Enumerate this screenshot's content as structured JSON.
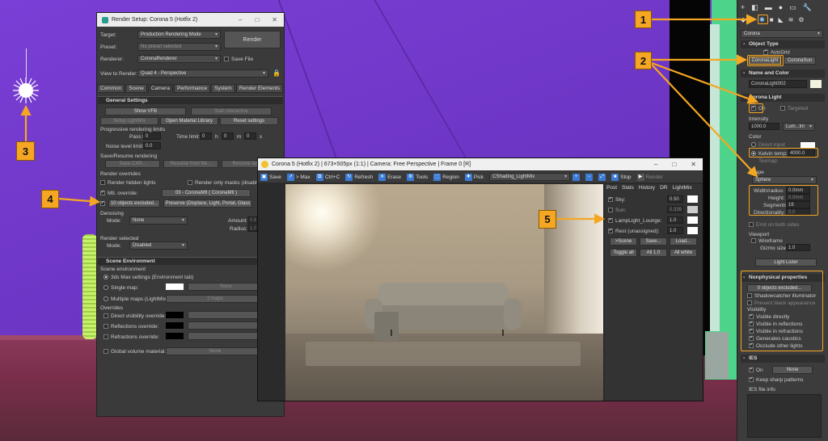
{
  "render_setup": {
    "title": "Render Setup: Corona 5 (Hotfix 2)",
    "target_label": "Target:",
    "target_value": "Production Rendering Mode",
    "preset_label": "Preset:",
    "preset_value": "No preset selected",
    "renderer_label": "Renderer:",
    "renderer_value": "CoronaRenderer",
    "save_file": "Save File",
    "render_button": "Render",
    "view_label": "View to Render:",
    "view_value": "Quad 4 - Perspective",
    "tabs": [
      "Common",
      "Scene",
      "Camera",
      "Performance",
      "System",
      "Render Elements"
    ],
    "general_settings": "General Settings",
    "show_vfb": "Show VFB",
    "start_interactive": "Start interactive",
    "setup_lightmix": "Setup LightMix",
    "open_material_library": "Open Material Library",
    "reset_settings": "Reset settings",
    "progressive_limits": "Progressive rendering limits",
    "pass_limit": "Pass limit:",
    "pass_limit_val": "0",
    "time_limit": "Time limit:",
    "time_h": "0",
    "time_m": "0",
    "time_s": "0",
    "h": "h",
    "m": "m",
    "s": "s",
    "noise_level": "Noise level limit:",
    "noise_val": "0.0",
    "save_resume": "Save/Resume rendering",
    "save_cxr": "Save CXR...",
    "resume_file": "Resume from file...",
    "resume_last": "Resume last",
    "render_overrides": "Render overrides",
    "render_hidden": "Render hidden lights",
    "render_masks": "Render only masks (disable s",
    "mtl_override": "Mtl. override:",
    "mtl_value": "03 - CoronaMtl  ( CoronaMtl )",
    "objects_excluded": "10 objects excluded...",
    "preserve": "Preserve (Displace, Light, Portal, Glass",
    "denoising": "Denoising",
    "mode_label": "Mode:",
    "denoise_mode": "None",
    "amount": "Amount:",
    "amount_val": "0.6",
    "radius": "Radius:",
    "radius_val": "1.0",
    "render_selected": "Render selected",
    "rs_mode": "Disabled",
    "scene_env": "Scene Environment",
    "scene_env_sub": "Scene environment",
    "max_settings": "3ds Max settings (Environment tab)",
    "single_map": "Single map:",
    "single_none": "None",
    "multiple_maps": "Multiple maps (LightMix):",
    "maps_count": "2 maps",
    "overrides": "Overrides",
    "direct_vis": "Direct visibility override:",
    "reflections": "Reflections override:",
    "refractions": "Refractions override:",
    "global_volume": "Global volume material:",
    "global_none": "None"
  },
  "vfb": {
    "title": "Corona 5 (Hotfix 2) | 673×505px (1:1) | Camera: Free Perspective | Frame 0 [R]",
    "toolbar": [
      "Save",
      "> Max",
      "Ctrl+C",
      "Refresh",
      "Erase",
      "Tools",
      "Region",
      "Pick"
    ],
    "element": "CShading_LightMix",
    "stop": "Stop",
    "render": "Render",
    "tabs": [
      "Post",
      "Stats",
      "History",
      "DR",
      "LightMix"
    ],
    "rows": [
      {
        "label": "Sky:",
        "value": "0.50",
        "checked": true
      },
      {
        "label": "Sun:",
        "value": "0.339",
        "checked": false
      },
      {
        "label": "LampLight_Lounge:",
        "value": "1.0",
        "checked": true
      },
      {
        "label": "Rest (unassigned):",
        "value": "1.0",
        "checked": true
      }
    ],
    "btn_scene": ">Scene",
    "btn_save": "Save...",
    "btn_load": "Load...",
    "btn_toggle": "Toggle all",
    "btn_all10": "All 1.0",
    "btn_white": "All white"
  },
  "panel": {
    "dropdown": "Corona",
    "object_type": "Object Type",
    "autogrid": "AutoGrid",
    "corona_light": "CoronaLight",
    "corona_sun": "CoronaSun",
    "name_color": "Name and Color",
    "name_value": "CoronaLight002",
    "corona_light_sec": "Corona Light",
    "on": "On",
    "targeted": "Targeted",
    "intensity": "Intensity",
    "intensity_val": "1000.0",
    "unit": "Lum...lm",
    "color": "Color",
    "direct_input": "Direct input",
    "kelvin": "Kelvin temp:",
    "kelvin_val": "4000.0",
    "texmap": "Texmap:",
    "shape": "Shape",
    "shape_val": "Sphere",
    "width_radius": "Width/radius:",
    "width_val": "0.0mm",
    "height": "Height:",
    "height_val": "0.0mm",
    "segments": "Segments:",
    "segments_val": "16",
    "directionality": "Directionality:",
    "dir_val": "0.0",
    "emit_both": "Emit on both sides",
    "viewport": "Viewport",
    "wireframe": "Wireframe",
    "gizmo": "Gizmo size:",
    "gizmo_val": "1.0",
    "light_lister": "Light Lister",
    "nonphysical": "Nonphysical properties",
    "objects_excluded": "0 objects excluded...",
    "shadowcatcher": "Shadowcatcher illuminator",
    "prevent_black": "Prevent black appearance",
    "visibility": "Visibility",
    "visible_directly": "Visible directly",
    "visible_reflections": "Visible in reflections",
    "visible_refractions": "Visible in refractions",
    "generates_caustics": "Generates caustics",
    "occlude": "Occlude other lights",
    "ies": "IES",
    "ies_on": "On",
    "ies_none": "None",
    "keep_sharp": "Keep sharp patterns",
    "ies_info": "IES file info"
  },
  "callouts": [
    "1",
    "2",
    "3",
    "4",
    "5"
  ],
  "colors": {
    "accent": "#f5a623",
    "viewport": "#6d35c4",
    "green": "#4ed38a"
  }
}
